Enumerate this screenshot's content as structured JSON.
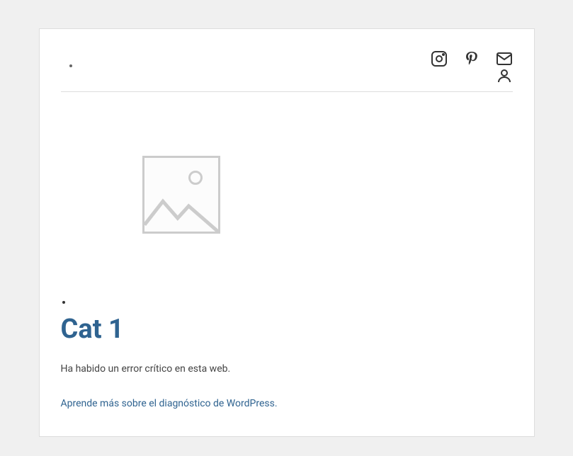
{
  "category": {
    "title": "Cat 1"
  },
  "error": {
    "message": "Ha habido un error crítico en esta web.",
    "learn_more": "Aprende más sobre el diagnóstico de WordPress."
  },
  "social": {
    "instagram": "Instagram",
    "pinterest": "Pinterest",
    "mail": "Mail",
    "account": "Account"
  }
}
